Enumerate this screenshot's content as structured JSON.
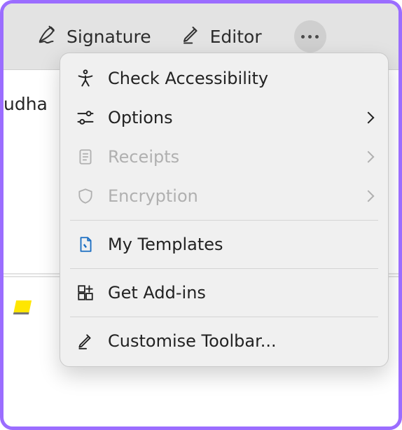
{
  "toolbar": {
    "signature_label": "Signature",
    "editor_label": "Editor"
  },
  "background": {
    "partial_text": "udha"
  },
  "menu": {
    "accessibility_label": "Check Accessibility",
    "options_label": "Options",
    "receipts_label": "Receipts",
    "encryption_label": "Encryption",
    "templates_label": "My Templates",
    "addins_label": "Get Add-ins",
    "customise_label": "Customise Toolbar..."
  }
}
